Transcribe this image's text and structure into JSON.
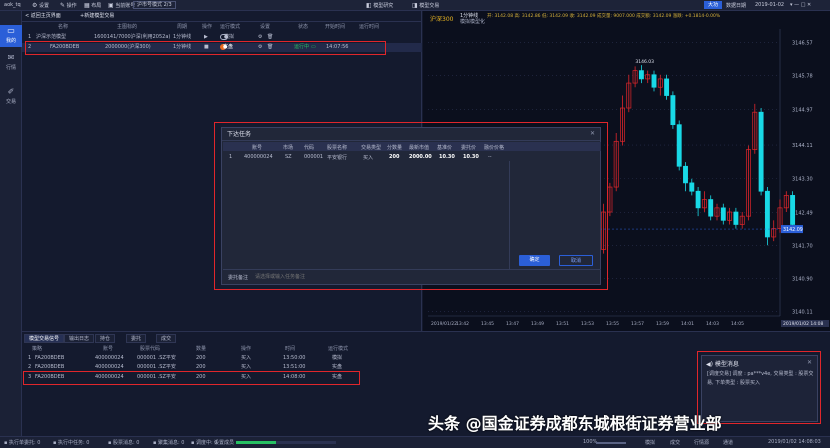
{
  "topbar": {
    "app": "aok_tq",
    "settings": "设置",
    "operate": "操作",
    "layout": "布局",
    "account": "当前账号",
    "mode": "沪市号模式 2/3",
    "model_research": "模型研究",
    "model_trade": "模型交易",
    "title_btn": "大功",
    "date_label": "数据日期",
    "date_value": "2019-01-02"
  },
  "leftnav": [
    {
      "icon": "monitor-icon",
      "label": "我的"
    },
    {
      "icon": "chart-icon",
      "label": "行情"
    },
    {
      "icon": "trade-icon",
      "label": "交易"
    }
  ],
  "list": {
    "back": "< 返回主页界面",
    "new": "+新建模型交易",
    "headers": [
      "名称",
      "主图标的",
      "周期",
      "操作",
      "运行模式",
      "设置",
      "状态",
      "开始时间",
      "运行时间"
    ],
    "rows": [
      {
        "idx": "1",
        "name": "沪深示范模型",
        "target": "1600141/7000沪深(利用2052a)",
        "period": "1分钟线",
        "mode": "模拟",
        "status": "",
        "start": "",
        "run": ""
      },
      {
        "idx": "2",
        "name": "FA200BDEB",
        "target": "2000000(沪深300)",
        "period": "1分钟线",
        "mode": "实盘",
        "status": "运行中",
        "start": "14:07:56",
        "run": ""
      }
    ]
  },
  "chart": {
    "symbol": "沪深300",
    "period": "1分钟线",
    "sub": "模拟模型化",
    "info": "开: 3142.08  高: 3142.86  低: 3142.09  收: 3142.09  成交量: 9007.000  成交额: 3142.09  涨跌: +0.1814-0.00%",
    "peak_label": "3146.03",
    "last_price": "3142.09",
    "y_ticks": [
      "3146.57",
      "3145.78",
      "3144.97",
      "3144.11",
      "3143.30",
      "3142.49",
      "3141.70",
      "3140.90",
      "3140.11"
    ],
    "x_ticks": [
      "2019/01/22",
      "13:42",
      "13:45",
      "13:47",
      "13:49",
      "13:51",
      "13:53",
      "13:55",
      "13:57",
      "13:59",
      "14:01",
      "14:03",
      "14:05"
    ],
    "x_last": "2019/01/02 14:08",
    "up_color": "#e0262b",
    "down_color": "#19d9e6",
    "candles": [
      {
        "o": 3141.1,
        "c": 3141.3,
        "h": 3141.4,
        "l": 3141.0
      },
      {
        "o": 3141.3,
        "c": 3141.6,
        "h": 3141.7,
        "l": 3141.2
      },
      {
        "o": 3141.6,
        "c": 3142.5,
        "h": 3142.7,
        "l": 3141.5
      },
      {
        "o": 3142.5,
        "c": 3143.1,
        "h": 3143.2,
        "l": 3142.4
      },
      {
        "o": 3143.1,
        "c": 3144.2,
        "h": 3144.4,
        "l": 3143.0
      },
      {
        "o": 3144.2,
        "c": 3145.0,
        "h": 3145.3,
        "l": 3144.1
      },
      {
        "o": 3145.0,
        "c": 3145.6,
        "h": 3145.8,
        "l": 3144.9
      },
      {
        "o": 3145.6,
        "c": 3145.9,
        "h": 3146.0,
        "l": 3145.5
      },
      {
        "o": 3145.9,
        "c": 3145.7,
        "h": 3146.03,
        "l": 3145.6
      },
      {
        "o": 3145.7,
        "c": 3145.8,
        "h": 3145.9,
        "l": 3145.6
      },
      {
        "o": 3145.8,
        "c": 3145.5,
        "h": 3145.9,
        "l": 3145.4
      },
      {
        "o": 3145.5,
        "c": 3145.7,
        "h": 3145.8,
        "l": 3145.3
      },
      {
        "o": 3145.7,
        "c": 3145.3,
        "h": 3145.8,
        "l": 3145.2
      },
      {
        "o": 3145.3,
        "c": 3144.6,
        "h": 3145.4,
        "l": 3144.5
      },
      {
        "o": 3144.6,
        "c": 3143.6,
        "h": 3144.7,
        "l": 3143.5
      },
      {
        "o": 3143.6,
        "c": 3143.2,
        "h": 3143.7,
        "l": 3143.0
      },
      {
        "o": 3143.2,
        "c": 3143.0,
        "h": 3143.3,
        "l": 3142.9
      },
      {
        "o": 3143.0,
        "c": 3142.6,
        "h": 3143.1,
        "l": 3142.4
      },
      {
        "o": 3142.6,
        "c": 3142.8,
        "h": 3143.0,
        "l": 3142.5
      },
      {
        "o": 3142.8,
        "c": 3142.4,
        "h": 3142.9,
        "l": 3142.3
      },
      {
        "o": 3142.4,
        "c": 3142.6,
        "h": 3142.7,
        "l": 3142.3
      },
      {
        "o": 3142.6,
        "c": 3142.3,
        "h": 3142.7,
        "l": 3142.2
      },
      {
        "o": 3142.3,
        "c": 3142.5,
        "h": 3142.6,
        "l": 3142.2
      },
      {
        "o": 3142.5,
        "c": 3142.2,
        "h": 3142.6,
        "l": 3142.1
      },
      {
        "o": 3142.2,
        "c": 3142.4,
        "h": 3142.5,
        "l": 3142.1
      },
      {
        "o": 3142.4,
        "c": 3144.0,
        "h": 3144.1,
        "l": 3142.3
      },
      {
        "o": 3144.0,
        "c": 3144.9,
        "h": 3145.1,
        "l": 3143.9
      },
      {
        "o": 3144.9,
        "c": 3143.0,
        "h": 3145.0,
        "l": 3142.9
      },
      {
        "o": 3143.0,
        "c": 3141.9,
        "h": 3143.1,
        "l": 3141.7
      },
      {
        "o": 3141.9,
        "c": 3142.1,
        "h": 3142.3,
        "l": 3141.8
      },
      {
        "o": 3142.1,
        "c": 3142.6,
        "h": 3142.8,
        "l": 3142.0
      },
      {
        "o": 3142.6,
        "c": 3142.9,
        "h": 3143.0,
        "l": 3142.5
      },
      {
        "o": 3142.9,
        "c": 3142.2,
        "h": 3143.0,
        "l": 3142.0
      }
    ]
  },
  "dialog": {
    "title": "下达任务",
    "headers": [
      "",
      "账号",
      "市场",
      "代码",
      "股票名称",
      "交易类型",
      "分数量",
      "最新市值",
      "基准价",
      "委托价",
      "融价价格"
    ],
    "row": [
      "1",
      "400000024",
      "SZ",
      "000001",
      "平安银行",
      "买入",
      "200",
      "2000.00",
      "10.30",
      "10.30",
      "--"
    ],
    "remark_label": "委托备注",
    "remark_placeholder": "请选择或输入任务备注",
    "ok": "确定",
    "cancel": "取消"
  },
  "bottom": {
    "tabs": [
      "模型交易信号",
      "输出日志",
      "持仓",
      "委托",
      "成交"
    ],
    "headers": [
      "",
      "策略",
      "账号",
      "股票代码",
      "数量",
      "操作",
      "时间",
      "运行模式"
    ],
    "rows": [
      [
        "1",
        "FA200BDEB",
        "400000024",
        "000001 .SZ平安",
        "200",
        "买入",
        "13:50:00",
        "模拟"
      ],
      [
        "2",
        "FA200BDEB",
        "400000024",
        "000001 .SZ平安",
        "200",
        "买入",
        "13:51:00",
        "实盘"
      ],
      [
        "3",
        "FA200BDEB",
        "400000024",
        "000001 .SZ平安",
        "200",
        "买入",
        "14:08:00",
        "实盘"
      ]
    ]
  },
  "toast": {
    "title": "模型消息",
    "body": "[调度交易] 调度 : pa***v4e,  交易类型 : 股票交易, 下单类型 : 股票买入"
  },
  "status": {
    "items": [
      "执行单委托: 0",
      "执行中任务: 0",
      "股票消息: 0",
      "聚集消息: 0",
      "调度中: 0",
      "设置成员"
    ],
    "zoom": "100%",
    "right": [
      "模拟",
      "成交",
      "行情源",
      "通道",
      "2019/01/02 14:08:03"
    ]
  },
  "watermark": "头条 @国金证券成都东城根街证券营业部"
}
